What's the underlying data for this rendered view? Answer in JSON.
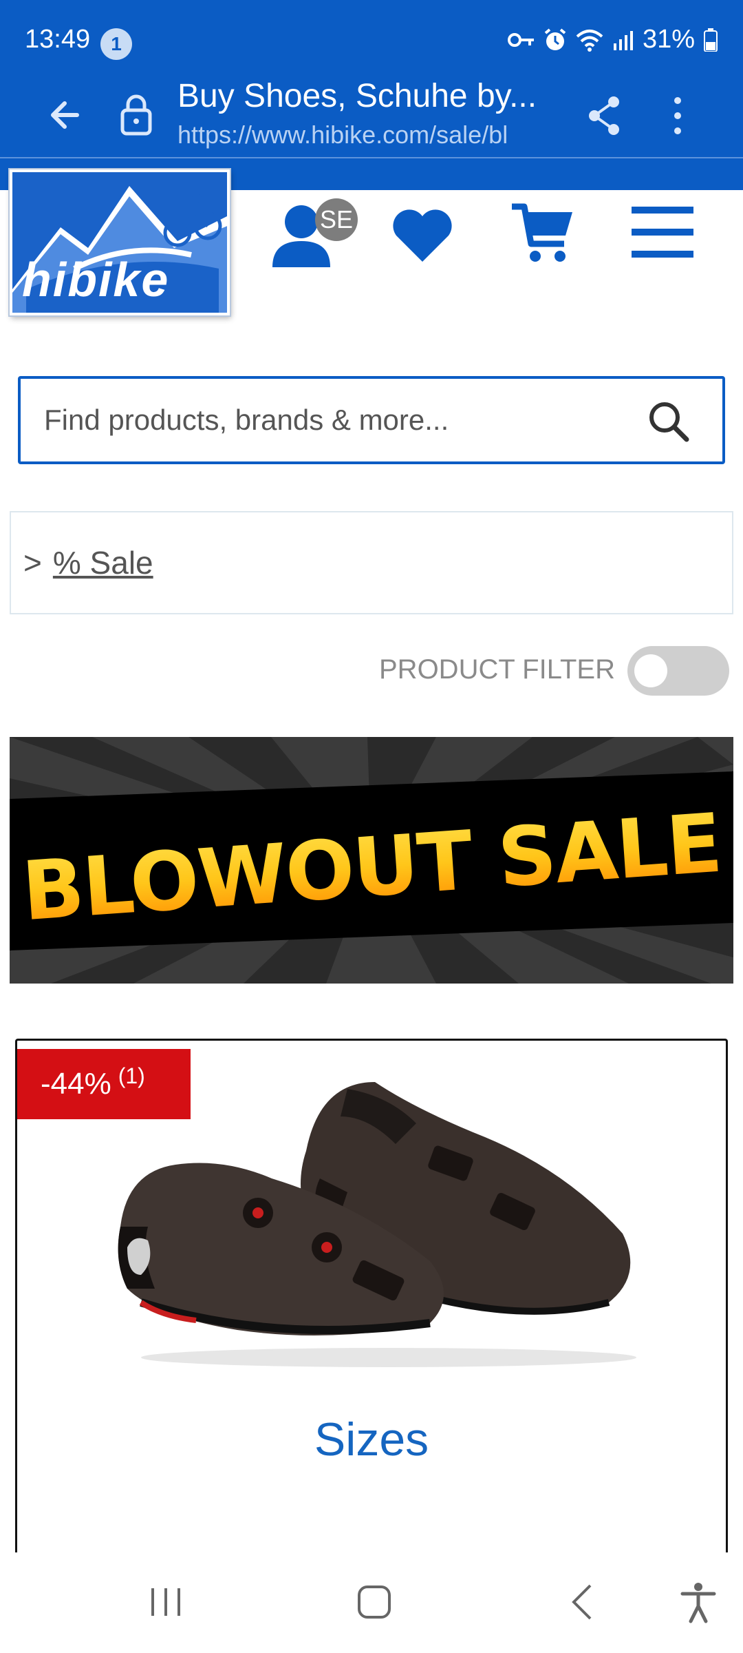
{
  "status_bar": {
    "time": "13:49",
    "notification_count": "1",
    "battery": "31%"
  },
  "url_bar": {
    "title": "Buy Shoes, Schuhe by...",
    "address": "https://www.hibike.com/sale/bl"
  },
  "header": {
    "logo_text": "hibike",
    "account_badge": "SE"
  },
  "search": {
    "placeholder": "Find products, brands & more..."
  },
  "breadcrumb": {
    "separator": ">",
    "link": "% Sale"
  },
  "filter": {
    "label": "PRODUCT FILTER",
    "enabled": false
  },
  "banner": {
    "text": "BLOWOUT SALE"
  },
  "product": {
    "discount": "-44%",
    "discount_note": "(1)",
    "sizes_label": "Sizes"
  },
  "colors": {
    "brand_blue": "#0b5cc4",
    "sale_red": "#d40f14",
    "link_blue": "#1565c0"
  },
  "icons": [
    "back-arrow-icon",
    "lock-icon",
    "share-icon",
    "more-vert-icon",
    "user-icon",
    "heart-icon",
    "cart-icon",
    "menu-icon",
    "search-icon",
    "recents-icon",
    "home-icon",
    "back-icon",
    "accessibility-icon"
  ]
}
